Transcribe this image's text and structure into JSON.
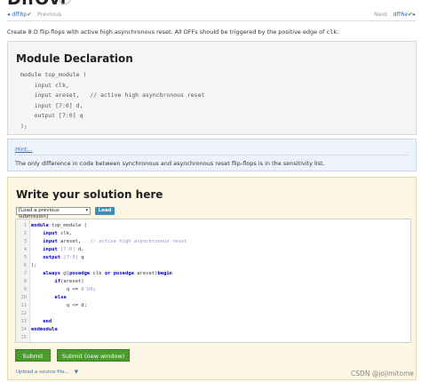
{
  "page": {
    "title": "DffOvr",
    "description_pre": "Create 8 D flip-flops with active high asynchronous reset. All DFFs should be triggered by the positive edge of ",
    "description_code": "clk",
    "description_post": "."
  },
  "nav": {
    "prev_arrow": "◂",
    "prev_problem": "dff8p",
    "prev_check": "✔",
    "prev_label": "Previous",
    "next_label": "Next",
    "next_problem": "dff8e",
    "next_check": "✔",
    "next_arrow": "▸"
  },
  "module_declaration": {
    "heading": "Module Declaration",
    "code": "module top_module (\n    input clk,\n    input areset,   // active high asynchronous reset\n    input [7:0] d,\n    output [7:0] q\n);"
  },
  "hint": {
    "link_label": "Hint...",
    "text": "The only difference in code between synchronous and asynchronous reset flip-flops is in the sensitivity list."
  },
  "solution": {
    "heading": "Write your solution here",
    "load_select_value": "[Load a previous submission]",
    "load_button": "Load",
    "line_numbers": [
      "1",
      "2",
      "3",
      "4",
      "5",
      "6",
      "7",
      "8",
      "9",
      "10",
      "11",
      "12",
      "13",
      "14",
      "15"
    ],
    "submit_button": "Submit",
    "submit_new_window_button": "Submit (new window)",
    "upload_link": "Upload a source file...",
    "upload_arrow": "▼"
  },
  "watermark": "CSDN @jojimitome",
  "colors": {
    "keyword": "#0000cc",
    "comment": "#9a8bd0",
    "submit_green": "#4a9c2d",
    "load_blue": "#3c8dbc",
    "link": "#3a6ea8"
  }
}
